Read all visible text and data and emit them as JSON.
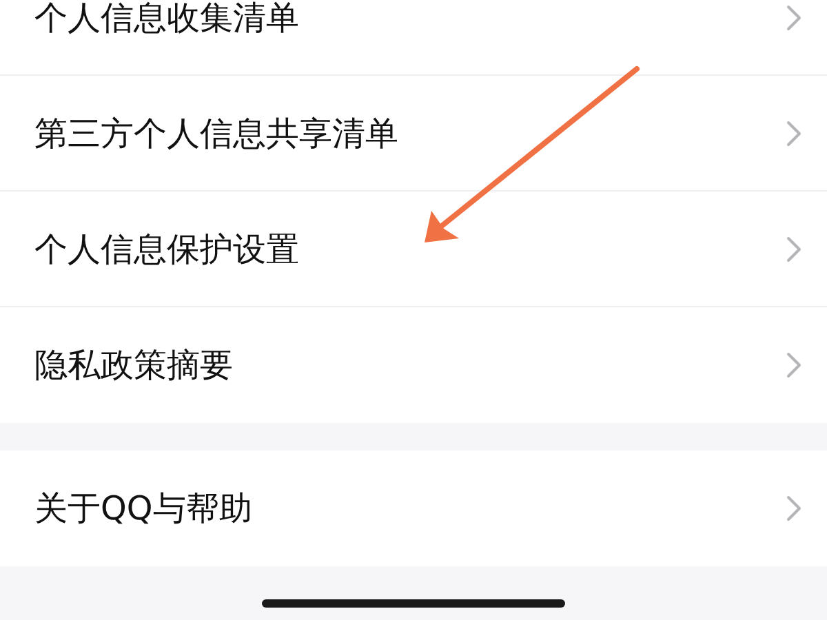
{
  "sections": [
    {
      "items": [
        {
          "label": "个人信息收集清单"
        },
        {
          "label": "第三方个人信息共享清单"
        },
        {
          "label": "个人信息保护设置"
        },
        {
          "label": "隐私政策摘要"
        }
      ]
    },
    {
      "items": [
        {
          "label": "关于QQ与帮助"
        }
      ]
    }
  ]
}
